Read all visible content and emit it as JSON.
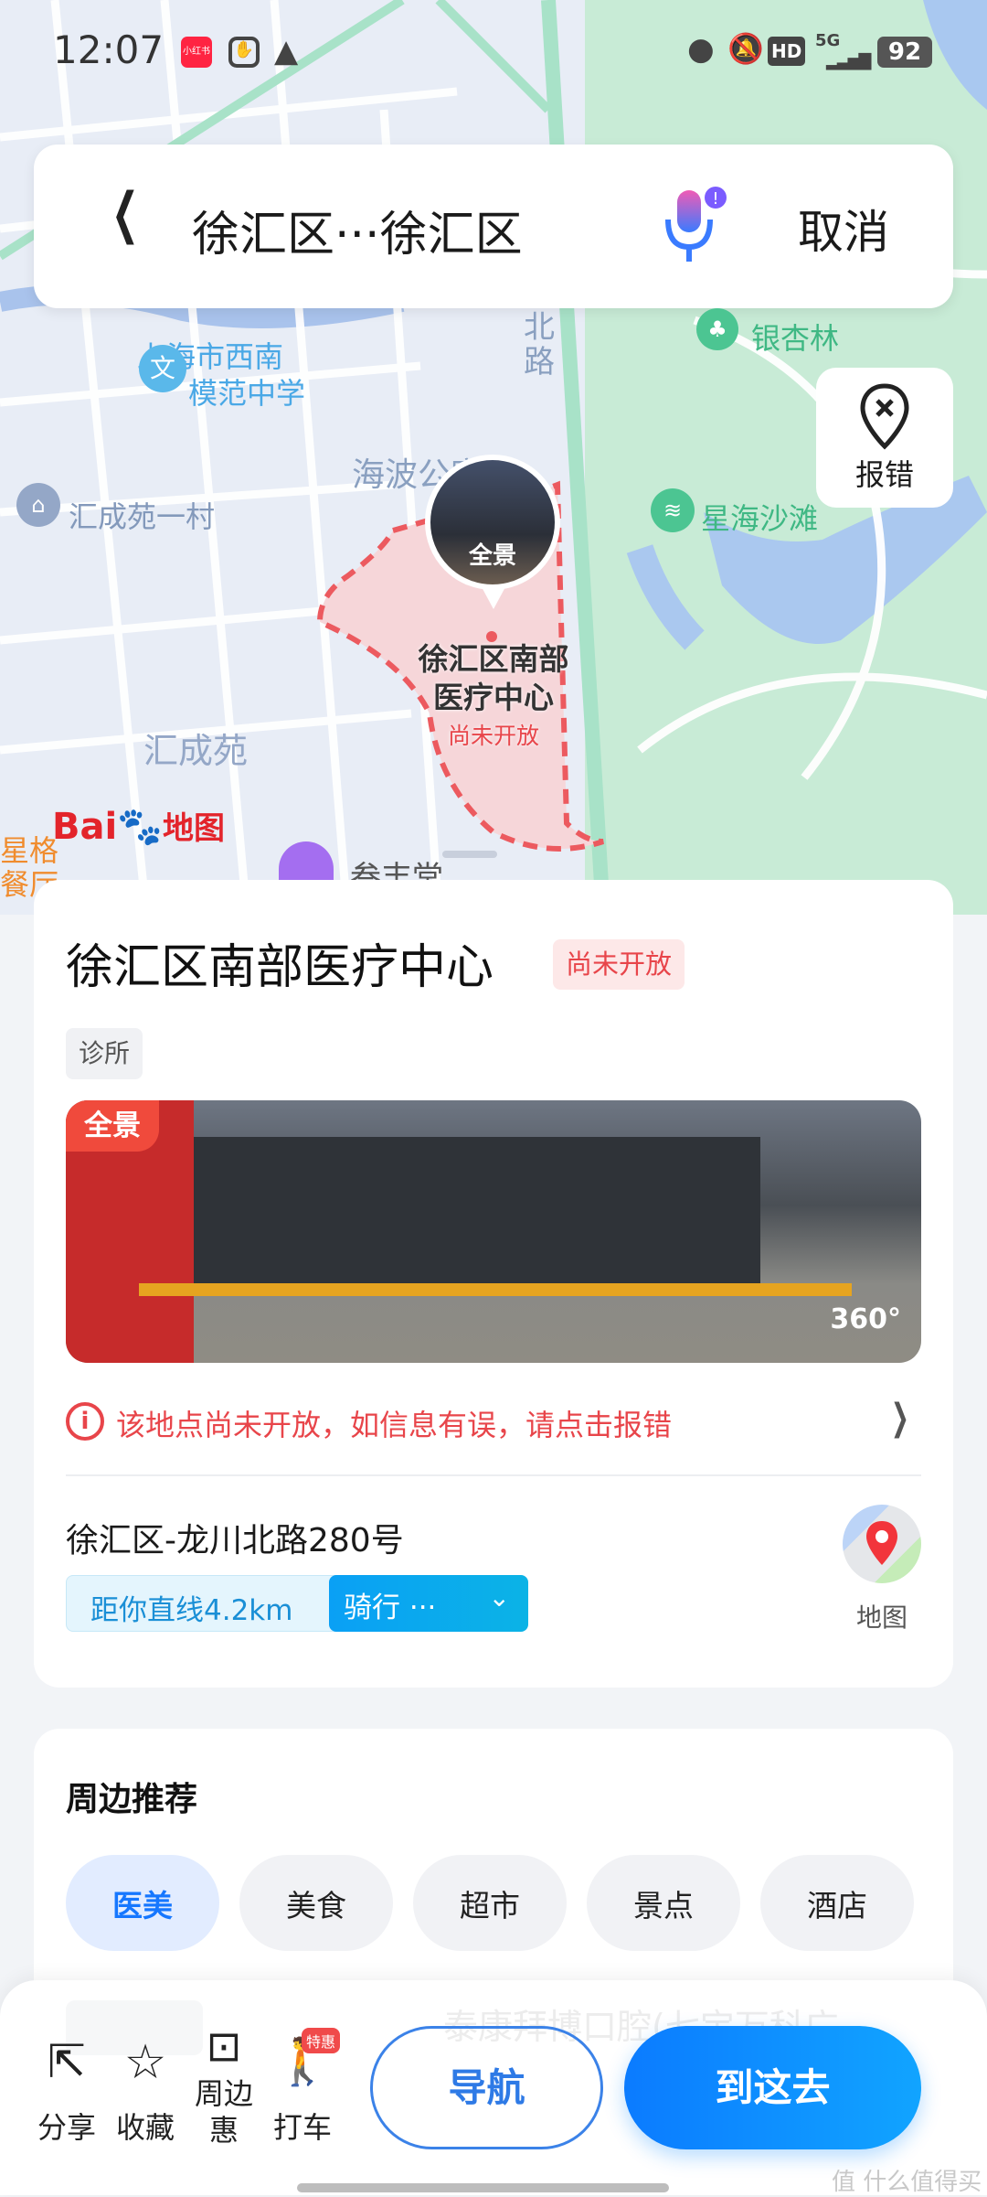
{
  "status_bar": {
    "time": "12:07",
    "app_badge": "小红书",
    "battery": "92",
    "network": "5G",
    "hd": "HD"
  },
  "search_bar": {
    "title": "徐汇区···徐汇区",
    "cancel": "取消"
  },
  "map": {
    "report_error": "报错",
    "labels": [
      "上海市西南",
      "模范中学",
      "银杏林",
      "海波公寓",
      "汇成苑一村",
      "星海沙滩",
      "汇成苑",
      "叁丰堂",
      "北",
      "路",
      "星格",
      "餐厅"
    ],
    "poi_name_line1": "徐汇区南部",
    "poi_name_line2": "医疗中心",
    "poi_status": "尚未开放",
    "panorama_label": "全景",
    "logo": "Baidu地图"
  },
  "place": {
    "name": "徐汇区南部医疗中心",
    "status_tag": "尚未开放",
    "category": "诊所",
    "panorama_label": "全景",
    "panorama_360": "360°",
    "warning": "该地点尚未开放，如信息有误，请点击报错",
    "address": "徐汇区-龙川北路280号",
    "distance": "距你直线4.2km",
    "mode": "骑行 ···",
    "map_label": "地图"
  },
  "nearby": {
    "title": "周边推荐",
    "chips": [
      "医美",
      "美食",
      "超市",
      "景点",
      "酒店"
    ],
    "active": 0,
    "preview": "泰康拜博口腔(七宝万科广…"
  },
  "bottom_bar": {
    "share": "分享",
    "favorite": "收藏",
    "deals_1": "周边",
    "deals_2": "惠",
    "taxi": "打车",
    "taxi_badge": "特惠",
    "navigate": "导航",
    "go_here": "到这去"
  },
  "watermark": "值 什么值得买",
  "colors": {
    "accent": "#1677ff",
    "red": "#e8454a",
    "park": "#c8ebd6"
  }
}
